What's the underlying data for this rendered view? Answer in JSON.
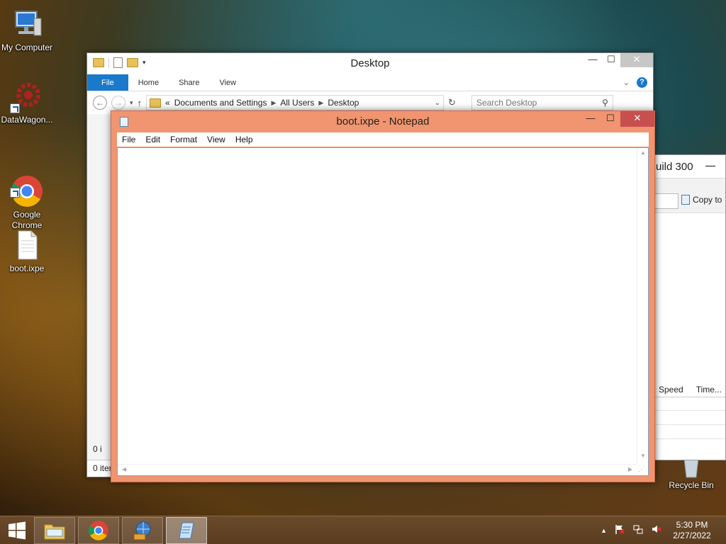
{
  "desktop": {
    "icons": [
      {
        "label": "My Computer"
      },
      {
        "label": "DataWagon..."
      },
      {
        "label": "Google\nChrome"
      },
      {
        "label": "boot.ixpe"
      },
      {
        "label": "Recycle Bin"
      }
    ]
  },
  "explorer": {
    "title": "Desktop",
    "ribbon_tabs": [
      "File",
      "Home",
      "Share",
      "View"
    ],
    "address": [
      "«",
      "Documents and Settings",
      "All Users",
      "Desktop"
    ],
    "search_placeholder": "Search Desktop",
    "status_top": "0 i",
    "status": "0 iter"
  },
  "background_window": {
    "title": "uild 300",
    "copy_label": "Copy to",
    "columns": [
      "Speed",
      "Time..."
    ]
  },
  "notepad": {
    "title": "boot.ixpe - Notepad",
    "menu": [
      "File",
      "Edit",
      "Format",
      "View",
      "Help"
    ],
    "content": ""
  },
  "taskbar": {
    "time": "5:30 PM",
    "date": "2/27/2022"
  },
  "colors": {
    "notepad_frame": "#f0956f",
    "close_button": "#c7504f",
    "ribbon_file": "#1979ca"
  }
}
